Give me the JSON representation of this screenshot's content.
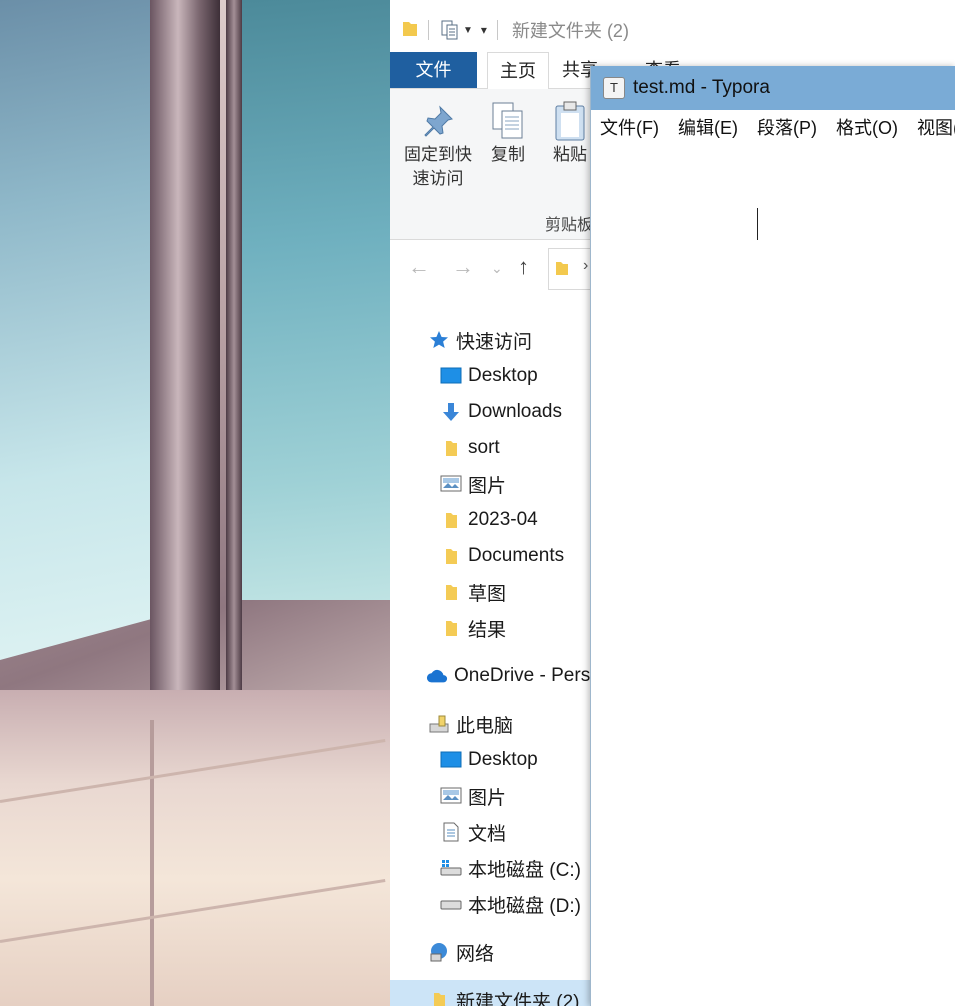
{
  "explorer": {
    "window_title": "新建文件夹 (2)",
    "ribbon_tabs": [
      "文件",
      "主页",
      "共享",
      "查看"
    ],
    "ribbon_buttons": {
      "pin": "固定到快速访问",
      "copy": "复制",
      "paste": "粘贴"
    },
    "clipboard_group": "剪贴板",
    "nav": {
      "quick_access": "快速访问",
      "qa_items": [
        "Desktop",
        "Downloads",
        "sort",
        "图片",
        "2023-04",
        "Documents",
        "草图",
        "结果"
      ],
      "onedrive": "OneDrive - Pers",
      "this_pc": "此电脑",
      "pc_items": [
        "Desktop",
        "图片",
        "文档",
        "本地磁盘 (C:)",
        "本地磁盘 (D:)"
      ],
      "network": "网络",
      "selected": "新建文件夹 (2)"
    }
  },
  "typora": {
    "title": "test.md - Typora",
    "menu": [
      "文件(F)",
      "编辑(E)",
      "段落(P)",
      "格式(O)",
      "视图(V)"
    ]
  },
  "colors": {
    "file_tab": "#1f5fa0",
    "typora_title": "#7aabd6",
    "selection": "#cce4f7"
  }
}
